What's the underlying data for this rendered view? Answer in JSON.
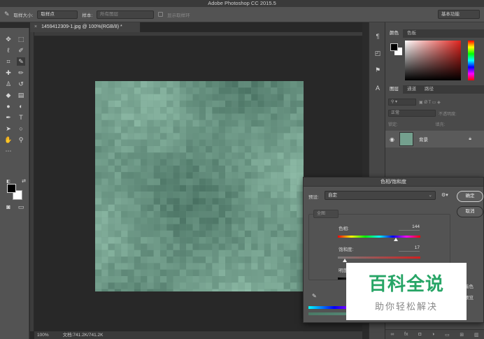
{
  "app": {
    "title": "Adobe Photoshop CC 2015.5"
  },
  "options_bar": {
    "sample_size_label": "取样大小:",
    "sample_size_value": "取样点",
    "sample_label": "样本:",
    "sample_value": "所有图层",
    "show_ring_label": "显示取样环",
    "workspace": "基本功能"
  },
  "document": {
    "tab_title": "1459412309-1.jpg @ 100%(RGB/8) *",
    "zoom": "100%",
    "doc_size": "文档:741.2K/741.2K"
  },
  "color_panel": {
    "tabs": [
      "颜色",
      "色板"
    ]
  },
  "layers_panel": {
    "tabs": [
      "图层",
      "通道",
      "路径"
    ],
    "blend_mode": "正常",
    "opacity_label": "不透明度:",
    "lock_label": "锁定:",
    "fill_label": "填充:",
    "layer_name": "背景"
  },
  "hue_sat_dialog": {
    "title": "色相/饱和度",
    "preset_label": "预设:",
    "preset_value": "自定",
    "ok": "确定",
    "cancel": "取消",
    "channel": "全图",
    "hue_label": "色相:",
    "hue_value": "144",
    "hue_level": 0.7,
    "saturation_label": "饱和度:",
    "saturation_value": "17",
    "saturation_level": 0.085,
    "lightness_label": "明度",
    "colorize_label": "着色",
    "preview_label": "预览"
  },
  "watermark": {
    "title": "百科全说",
    "subtitle": "助你轻松解决"
  },
  "colors": {
    "canvas_base": "#6f9a89",
    "panel_bg": "#535353",
    "watermark_green": "#27a566"
  }
}
